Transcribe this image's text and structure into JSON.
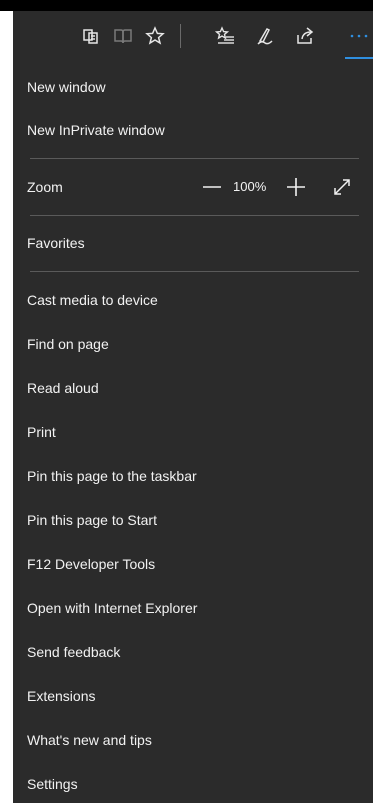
{
  "toolbar": {
    "icons": [
      "reading-view-icon",
      "book-icon",
      "favorite-star-icon",
      "favorites-list-icon",
      "web-note-icon",
      "share-icon",
      "more-icon"
    ],
    "accent_color": "#2f8fe0"
  },
  "menu": {
    "new_window": "New window",
    "new_inprivate_window": "New InPrivate window",
    "zoom": {
      "label": "Zoom",
      "value": "100%"
    },
    "favorites": "Favorites",
    "cast_media": "Cast media to device",
    "find_on_page": "Find on page",
    "read_aloud": "Read aloud",
    "print": "Print",
    "pin_taskbar": "Pin this page to the taskbar",
    "pin_start": "Pin this page to Start",
    "dev_tools": "F12 Developer Tools",
    "open_ie": "Open with Internet Explorer",
    "send_feedback": "Send feedback",
    "extensions": "Extensions",
    "whats_new": "What's new and tips",
    "settings": "Settings"
  }
}
